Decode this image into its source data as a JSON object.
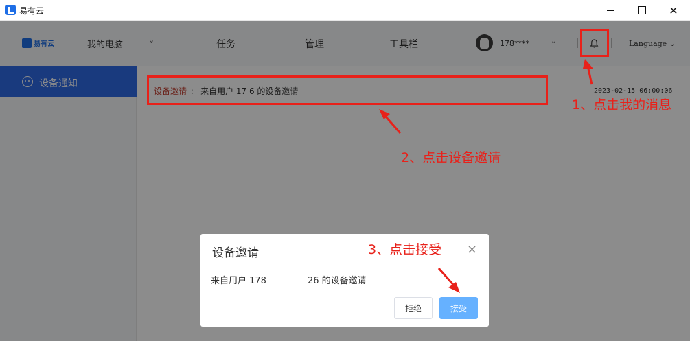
{
  "window": {
    "title": "易有云",
    "close_glyph": "✕"
  },
  "header": {
    "logo_text": "易有云",
    "nav": {
      "my_pc": "我的电脑",
      "chev": "⌄",
      "tasks": "任务",
      "manage": "管理",
      "toolbar": "工具栏"
    },
    "username": "178****",
    "user_chev": "⌄",
    "language": "Language ⌄"
  },
  "sidebar": {
    "items": [
      {
        "label": "设备通知",
        "icon": "message-icon"
      }
    ]
  },
  "main": {
    "notice": {
      "type": "设备邀请",
      "colon": ":",
      "text": "来自用户 17          6 的设备邀请",
      "date": "2023-02-15 06:00:06"
    }
  },
  "dialog": {
    "title": "设备邀请",
    "close": "×",
    "message_prefix": "来自用户 178",
    "message_suffix": "26 的设备邀请",
    "reject": "拒绝",
    "accept": "接受"
  },
  "annotations": {
    "step1": "1、点击我的消息",
    "step2": "2、点击设备邀请",
    "step3": "3、点击接受",
    "color": "#e8211a"
  },
  "colors": {
    "accent": "#2f6be6",
    "accept_button": "#66b1ff",
    "notice_type": "#c0392b"
  }
}
